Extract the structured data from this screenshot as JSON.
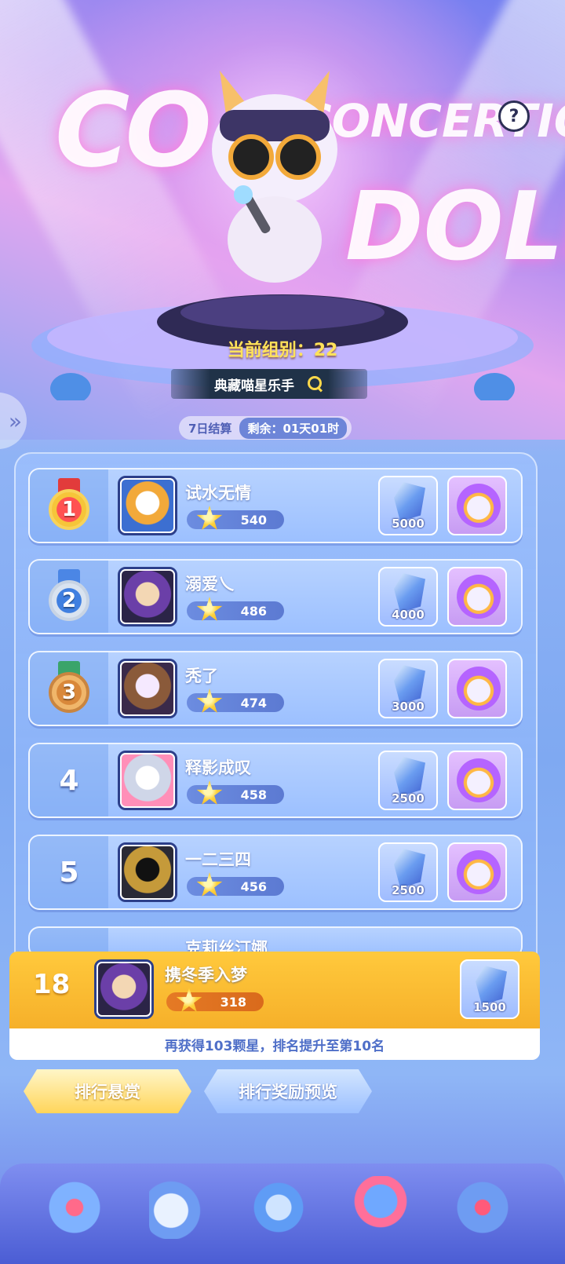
{
  "hero": {
    "title_line1": "CONCERTION",
    "title_line2": "DOLL",
    "help_label": "?",
    "group_label": "当前组别：22",
    "search_text": "典藏喵星乐手"
  },
  "settle": {
    "cycle": "7日结算",
    "remain": "剩余：01天01时"
  },
  "side_tab": "»",
  "ranking": [
    {
      "rank": "1",
      "medal": "gold",
      "name": "试水无情",
      "score": "540",
      "gems": "5000"
    },
    {
      "rank": "2",
      "medal": "silver",
      "name": "溺爱乀",
      "score": "486",
      "gems": "4000"
    },
    {
      "rank": "3",
      "medal": "bronze",
      "name": "秃了",
      "score": "474",
      "gems": "3000"
    },
    {
      "rank": "4",
      "medal": "",
      "name": "释影成叹",
      "score": "458",
      "gems": "2500"
    },
    {
      "rank": "5",
      "medal": "",
      "name": "一二三四",
      "score": "456",
      "gems": "2500"
    }
  ],
  "partial_row_name": "克莉丝汀娜",
  "my_rank": {
    "rank": "18",
    "name": "携冬季入梦",
    "score": "318",
    "gems": "1500",
    "hint": "再获得103颗星，排名提升至第10名"
  },
  "tabs": {
    "active": "排行悬赏",
    "inactive": "排行奖励预览"
  },
  "icons": {
    "help": "question-icon",
    "search": "search-icon",
    "score": "star-icon",
    "gem": "crystal-icon",
    "pet": "cat-pet-icon"
  },
  "colors": {
    "accent_gold": "#ffd23c",
    "my_row": "#f6b02a",
    "hint_text": "#4f6fc8"
  }
}
